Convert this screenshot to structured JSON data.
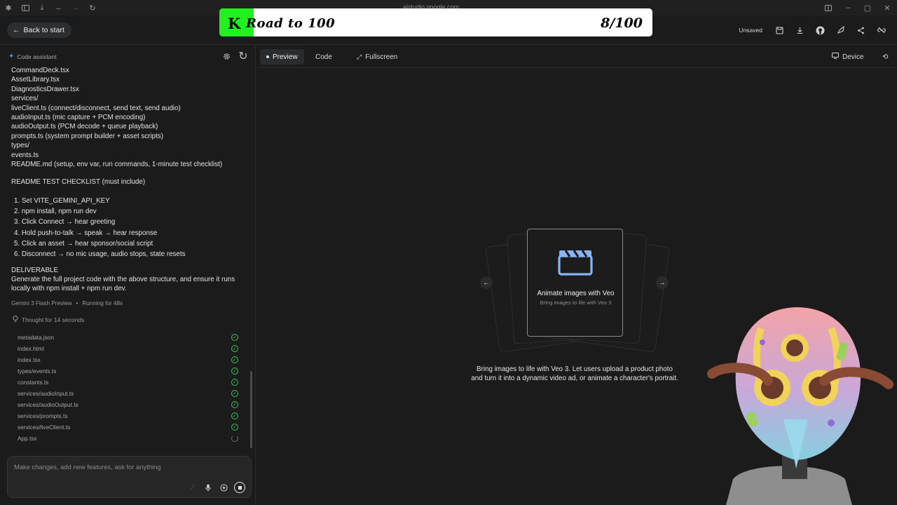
{
  "browser": {
    "url": "aistudio.google.com"
  },
  "banner": {
    "badge": "K",
    "title": "Road to 100",
    "counter": "8/100",
    "progress": 0.08
  },
  "appbar": {
    "back_label": "Back to start",
    "status": "Unsaved"
  },
  "assistant": {
    "header": "Code assistant",
    "message_lines": [
      "CommandDeck.tsx",
      "AssetLibrary.tsx",
      "DiagnosticsDrawer.tsx",
      "services/",
      "liveClient.ts (connect/disconnect, send text, send audio)",
      "audioInput.ts (mic capture + PCM encoding)",
      "audioOutput.ts (PCM decode + queue playback)",
      "prompts.ts (system prompt builder + asset scripts)",
      "types/",
      "events.ts",
      "README.md (setup, env var, run commands, 1-minute test checklist)"
    ],
    "checklist_heading": "README TEST CHECKLIST (must include)",
    "checklist": [
      "1. Set VITE_GEMINI_API_KEY",
      "2. npm install, npm run dev",
      "3. Click Connect → hear greeting",
      "4. Hold push-to-talk → speak → hear response",
      "5. Click an asset → hear sponsor/social script",
      "6. Disconnect → no mic usage, audio stops, state resets"
    ],
    "deliverable_heading": "DELIVERABLE",
    "deliverable_lines": [
      "Generate the full project code with the above structure, and ensure it runs",
      "locally with npm install + npm run dev."
    ],
    "model": "Gemini 3 Flash Preview",
    "running": "Running for 48s",
    "thought": "Thought for 14 seconds",
    "files": [
      {
        "name": "metadata.json",
        "status": "done"
      },
      {
        "name": "index.html",
        "status": "done"
      },
      {
        "name": "index.tsx",
        "status": "done"
      },
      {
        "name": "types/events.ts",
        "status": "done"
      },
      {
        "name": "constants.ts",
        "status": "done"
      },
      {
        "name": "services/audioInput.ts",
        "status": "done"
      },
      {
        "name": "services/audioOutput.ts",
        "status": "done"
      },
      {
        "name": "services/prompts.ts",
        "status": "done"
      },
      {
        "name": "services/liveClient.ts",
        "status": "done"
      },
      {
        "name": "App.tsx",
        "status": "loading"
      }
    ],
    "composer_placeholder": "Make changes, add new features, ask for anything"
  },
  "preview": {
    "tabs": [
      "Preview",
      "Code",
      "Fullscreen"
    ],
    "device_label": "Device",
    "card_title": "Animate images with Veo",
    "card_subtitle": "Bring images to life with Veo 3",
    "description_lines": [
      "Bring images to life with Veo 3. Let users upload a product photo",
      "and turn it into a dynamic video ad, or animate a character's portrait."
    ]
  },
  "colors": {
    "accent_blue": "#4c8df6",
    "success_green": "#37c55c",
    "banner_green": "#1ff21f"
  }
}
